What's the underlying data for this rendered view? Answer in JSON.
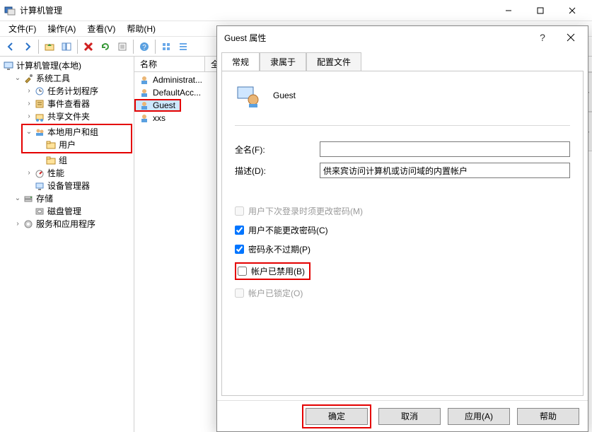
{
  "window": {
    "title": "计算机管理",
    "menus": {
      "file": "文件(F)",
      "action": "操作(A)",
      "view": "查看(V)",
      "help": "帮助(H)"
    },
    "winbtns": {
      "min": "minimize",
      "max": "maximize",
      "close": "close"
    }
  },
  "tree": {
    "root": "计算机管理(本地)",
    "systemTools": "系统工具",
    "taskScheduler": "任务计划程序",
    "eventViewer": "事件查看器",
    "sharedFolders": "共享文件夹",
    "localUsersGroups": "本地用户和组",
    "users": "用户",
    "groups": "组",
    "performance": "性能",
    "deviceManager": "设备管理器",
    "storage": "存储",
    "diskMgmt": "磁盘管理",
    "servicesApps": "服务和应用程序"
  },
  "list": {
    "col_name": "名称",
    "col_full": "全",
    "items": [
      "Administrat...",
      "DefaultAcc...",
      "Guest",
      "xxs"
    ]
  },
  "dialog": {
    "title": "Guest 属性",
    "tabs": {
      "general": "常规",
      "memberOf": "隶属于",
      "profile": "配置文件"
    },
    "header_name": "Guest",
    "fullname_label": "全名(F):",
    "fullname_value": "",
    "desc_label": "描述(D):",
    "desc_value": "供来宾访问计算机或访问域的内置帐户",
    "chk_mustchange": "用户下次登录时须更改密码(M)",
    "chk_cannotchange": "用户不能更改密码(C)",
    "chk_neverexpire": "密码永不过期(P)",
    "chk_disabled": "帐户已禁用(B)",
    "chk_locked": "帐户已锁定(O)",
    "btn_ok": "确定",
    "btn_cancel": "取消",
    "btn_apply": "应用(A)",
    "btn_help": "帮助"
  }
}
